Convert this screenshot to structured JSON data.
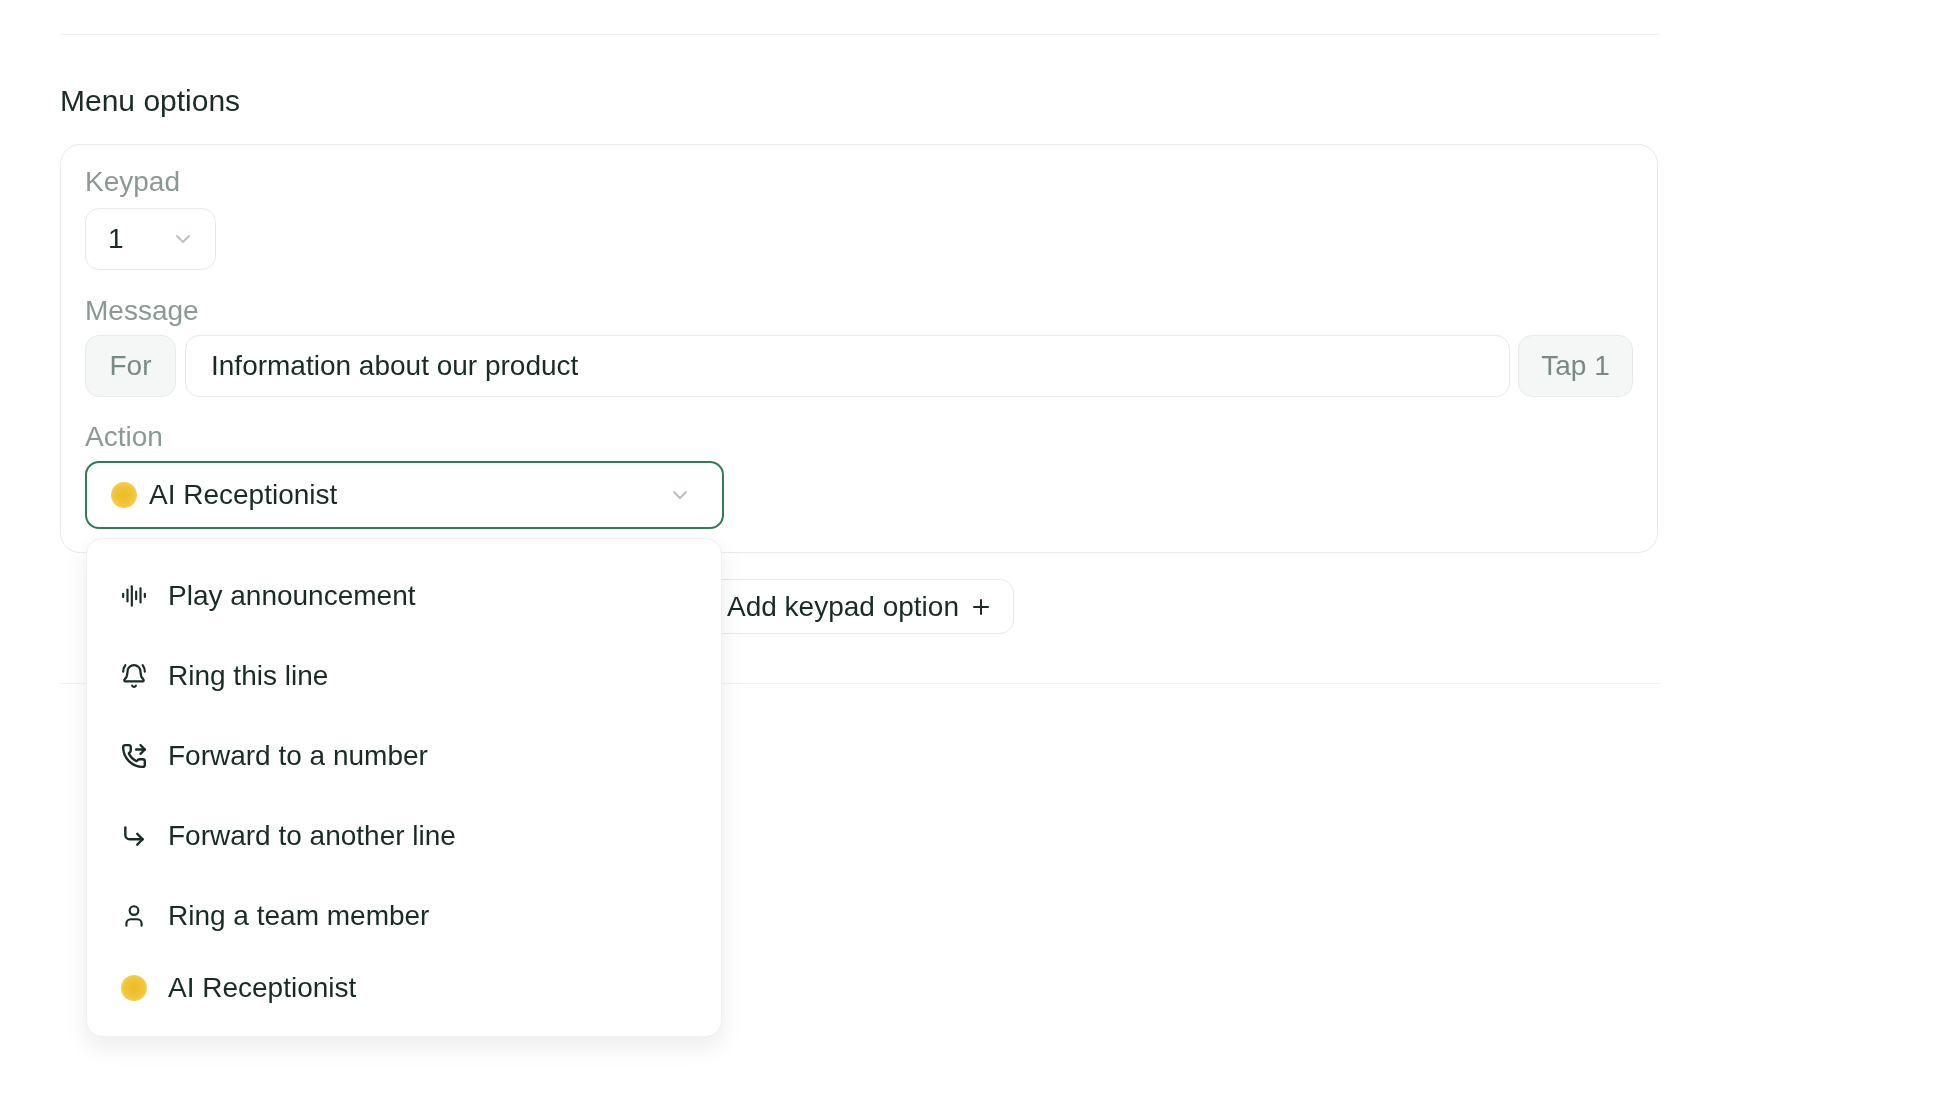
{
  "section": {
    "title": "Menu options"
  },
  "keypad_option": {
    "keypad": {
      "label": "Keypad",
      "value": "1"
    },
    "message": {
      "label": "Message",
      "prefix": "For",
      "value": "Information about our product",
      "suffix": "Tap 1"
    },
    "action": {
      "label": "Action",
      "value": "AI Receptionist",
      "kind": "ai",
      "focused": true,
      "expanded": true,
      "options": [
        {
          "label": "Play announcement",
          "kind": "announcement"
        },
        {
          "label": "Ring this line",
          "kind": "ring_line"
        },
        {
          "label": "Forward to a number",
          "kind": "forward_number"
        },
        {
          "label": "Forward to another line",
          "kind": "forward_line"
        },
        {
          "label": "Ring a team member",
          "kind": "team_member"
        },
        {
          "label": "AI Receptionist",
          "kind": "ai"
        }
      ]
    }
  },
  "add_button": {
    "label": "Add keypad option"
  }
}
